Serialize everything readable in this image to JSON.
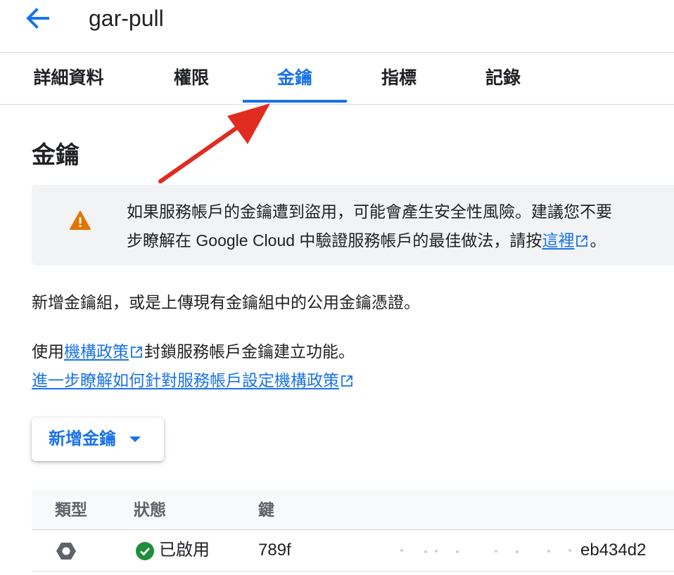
{
  "header": {
    "title": "gar-pull",
    "back_icon": "arrow-back-icon"
  },
  "tabs": [
    {
      "label": "詳細資料"
    },
    {
      "label": "權限"
    },
    {
      "label": "金鑰",
      "active": true
    },
    {
      "label": "指標"
    },
    {
      "label": "記錄"
    }
  ],
  "section": {
    "title": "金鑰"
  },
  "banner": {
    "icon": "warning-icon",
    "line1": "如果服務帳戶的金鑰遭到盜用，可能會產生安全性風險。建議您不要",
    "line2_prefix": "步瞭解在 Google Cloud 中驗證服務帳戶的最佳做法，請按",
    "line2_link": "這裡",
    "line2_suffix": "。"
  },
  "intro": {
    "text": "新增金鑰組，或是上傳現有金鑰組中的公用金鑰憑證。"
  },
  "policy": {
    "prefix": "使用",
    "link": "機構政策",
    "suffix": "封鎖服務帳戶金鑰建立功能。",
    "learn_more_link": "進一步瞭解如何針對服務帳戶設定機構政策"
  },
  "add_key_button": {
    "label": "新增金鑰"
  },
  "table": {
    "columns": [
      "類型",
      "狀態",
      "鍵"
    ],
    "rows": [
      {
        "type_icon": "key-type-icon",
        "status_icon": "check-circle-icon",
        "status": "已啟用",
        "key_prefix": "789f",
        "key_suffix": "eb434d2"
      }
    ]
  },
  "colors": {
    "accent": "#1a73e8",
    "warning": "#e37400",
    "success": "#1e8e3e",
    "banner_bg": "#f1f3f4"
  }
}
